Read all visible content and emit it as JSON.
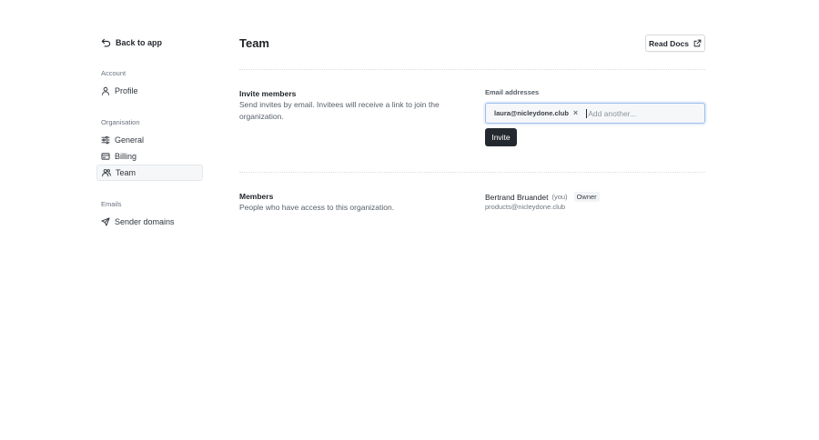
{
  "sidebar": {
    "back_label": "Back to app",
    "sections": [
      {
        "label": "Account",
        "items": [
          {
            "label": "Profile",
            "icon": "user-icon"
          }
        ]
      },
      {
        "label": "Organisation",
        "items": [
          {
            "label": "General",
            "icon": "sliders-icon"
          },
          {
            "label": "Billing",
            "icon": "credit-card-icon"
          },
          {
            "label": "Team",
            "icon": "users-icon",
            "active": true
          }
        ]
      },
      {
        "label": "Emails",
        "items": [
          {
            "label": "Sender domains",
            "icon": "send-icon"
          }
        ]
      }
    ]
  },
  "header": {
    "title": "Team",
    "docs_label": "Read Docs"
  },
  "invite": {
    "title": "Invite members",
    "description": "Send invites by email. Invitees will receive a link to join the organization.",
    "field_label": "Email addresses",
    "chip_email": "laura@nicleydone.club",
    "placeholder": "Add another...",
    "button_label": "Invite"
  },
  "members": {
    "title": "Members",
    "description": "People who have access to this organization.",
    "list": [
      {
        "name": "Bertrand Bruandet",
        "you": "(you)",
        "role": "Owner",
        "email": "products@nicleydone.club"
      }
    ]
  },
  "colors": {
    "accent_focus": "#9cbcf0",
    "primary_button": "#24292f"
  }
}
